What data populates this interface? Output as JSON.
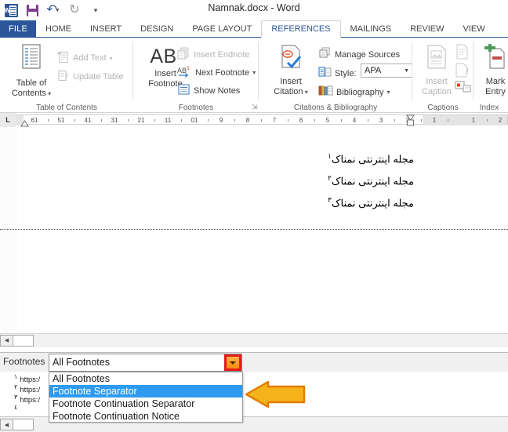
{
  "window": {
    "title": "Namnak.docx - Word",
    "quick_access": [
      {
        "name": "word-logo-icon",
        "label": "W"
      },
      {
        "name": "save-icon",
        "label": "Save"
      },
      {
        "name": "undo-icon",
        "label": "Undo"
      },
      {
        "name": "redo-icon",
        "label": "Redo"
      },
      {
        "name": "customize-quick-access-icon",
        "label": "Customize Quick Access Toolbar"
      }
    ]
  },
  "ribbon": {
    "file_tab": "FILE",
    "tabs": [
      {
        "label": "HOME",
        "active": false
      },
      {
        "label": "INSERT",
        "active": false
      },
      {
        "label": "DESIGN",
        "active": false
      },
      {
        "label": "PAGE LAYOUT",
        "active": false
      },
      {
        "label": "REFERENCES",
        "active": true
      },
      {
        "label": "MAILINGS",
        "active": false
      },
      {
        "label": "REVIEW",
        "active": false
      },
      {
        "label": "VIEW",
        "active": false
      }
    ],
    "groups": [
      {
        "name": "table-of-contents",
        "label": "Table of Contents",
        "big_button": {
          "line1": "Table of",
          "line2": "Contents",
          "has_caret": true
        },
        "small_buttons": [
          {
            "label": "Add Text",
            "disabled": true,
            "has_caret": true
          },
          {
            "label": "Update Table",
            "disabled": true,
            "has_caret": false
          }
        ]
      },
      {
        "name": "footnotes",
        "label": "Footnotes",
        "big_button": {
          "glyph": "AB",
          "sup": "1",
          "line1": "Insert",
          "line2": "Footnote"
        },
        "small_buttons": [
          {
            "label": "Insert Endnote",
            "disabled": true
          },
          {
            "label": "Next Footnote",
            "disabled": false,
            "has_caret": true
          },
          {
            "label": "Show Notes",
            "disabled": false
          }
        ]
      },
      {
        "name": "citations-bibliography",
        "label": "Citations & Bibliography",
        "big_button": {
          "line1": "Insert",
          "line2": "Citation",
          "has_caret": true
        },
        "small_buttons": [
          {
            "label": "Manage Sources"
          },
          {
            "label": "Style:"
          },
          {
            "label": "Bibliography",
            "has_caret": true
          }
        ],
        "style_value": "APA"
      },
      {
        "name": "captions",
        "label": "Captions",
        "big_button": {
          "line1": "Insert",
          "line2": "Caption",
          "disabled": true
        }
      },
      {
        "name": "index",
        "label": "Index",
        "big_button": {
          "line1": "Mark",
          "line2": "Entry"
        }
      }
    ]
  },
  "ruler": {
    "corner_marker": "L",
    "labels_left": [
      "61",
      "51",
      "41",
      "31",
      "21",
      "11",
      "01",
      "9",
      "8",
      "7",
      "6",
      "5",
      "4",
      "3",
      "2",
      "1"
    ],
    "labels_right": [
      "1",
      "2"
    ]
  },
  "document": {
    "paragraphs": [
      {
        "text": "مجله اینترنتی نمناک",
        "footnote_mark": "١"
      },
      {
        "text": "مجله اینترنتی نمناک",
        "footnote_mark": "٢"
      },
      {
        "text": "مجله اینترنتی نمناک",
        "footnote_mark": "٣"
      }
    ]
  },
  "footnote_pane": {
    "label": "Footnotes",
    "combo_value": "All Footnotes",
    "dropdown_options": [
      {
        "label": "All Footnotes",
        "selected": false
      },
      {
        "label": "Footnote Separator",
        "selected": true
      },
      {
        "label": "Footnote Continuation Separator",
        "selected": false
      },
      {
        "label": "Footnote Continuation Notice",
        "selected": false
      }
    ],
    "notes": [
      {
        "mark": "١",
        "text": "https:/"
      },
      {
        "mark": "٢",
        "text": "https:/"
      },
      {
        "mark": "٣",
        "text": "https:/"
      },
      {
        "mark": "٤",
        "text": ""
      }
    ]
  },
  "annotation": {
    "arrow_color": "#f5b31b",
    "arrow_border": "#e07b00",
    "direction": "left"
  },
  "colors": {
    "accent_blue": "#2b579a",
    "highlight_blue": "#2e9bf0",
    "callout_red": "#e21b1b",
    "callout_orange": "#ff9a26"
  }
}
